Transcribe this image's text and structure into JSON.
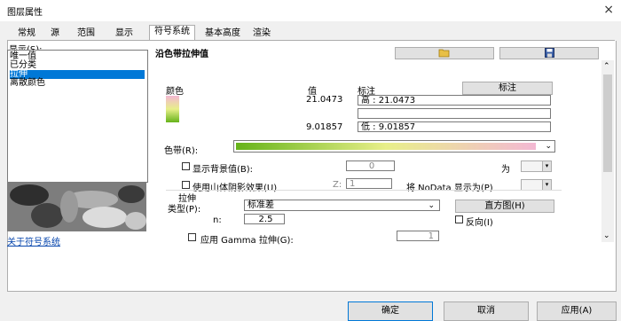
{
  "window": {
    "title": "图层属性",
    "close": "×"
  },
  "tabs": [
    "常规",
    "源",
    "范围",
    "显示",
    "符号系统",
    "基本高度",
    "渲染"
  ],
  "display_label": "显示(S):",
  "render_types": [
    "唯一值",
    "已分类",
    "拉伸",
    "离散颜色"
  ],
  "selected_render": "拉伸",
  "about_link": "关于符号系统",
  "section_title": "沿色带拉伸值",
  "colors": {
    "accent": "#0078d7",
    "ramp_start": "#66b31a",
    "ramp_mid": "#e8ef8a",
    "ramp_end": "#f3b8d3"
  },
  "headers": {
    "color": "颜色",
    "value": "值",
    "label": "标注",
    "label_button": "标注"
  },
  "high": {
    "value": "21.0473",
    "label": "高 : 21.0473"
  },
  "low": {
    "value": "9.01857",
    "label": "低 : 9.01857"
  },
  "color_ramp_label": "色带(R):",
  "background": {
    "label": "显示背景值(B):",
    "value": "0",
    "as_label": "为"
  },
  "hillshade": {
    "label": "使用山体阴影效果(U)",
    "z_label": "Z:",
    "z_value": "1",
    "nodata_label": "将 NoData 显示为(P)"
  },
  "stretch": {
    "title": "拉伸",
    "type_label": "类型(P):",
    "type_value": "标准差",
    "n_label": "n:",
    "n_value": "2.5",
    "histogram_button": "直方图(H)",
    "invert_label": "反向(I)",
    "gamma_label": "应用 Gamma 拉伸(G):",
    "gamma_value": "1"
  },
  "buttons": {
    "ok": "确定",
    "cancel": "取消",
    "apply": "应用(A)"
  },
  "icons": {
    "open": "folder-open-icon",
    "save": "save-icon"
  }
}
